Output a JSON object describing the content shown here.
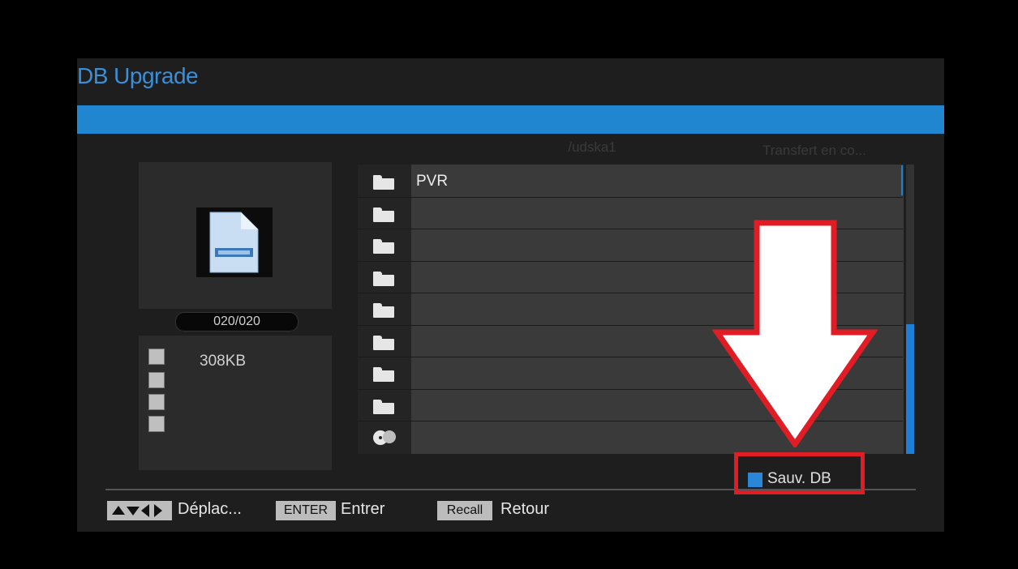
{
  "window": {
    "title": "DB Upgrade"
  },
  "browser": {
    "path": "/udska1",
    "status": "Transfert en co...",
    "rows": [
      {
        "icon": "folder-icon",
        "label": "PVR"
      },
      {
        "icon": "folder-icon",
        "label": ""
      },
      {
        "icon": "folder-icon",
        "label": ""
      },
      {
        "icon": "folder-icon",
        "label": ""
      },
      {
        "icon": "folder-icon",
        "label": ""
      },
      {
        "icon": "folder-icon",
        "label": ""
      },
      {
        "icon": "folder-icon",
        "label": ""
      },
      {
        "icon": "folder-icon",
        "label": ""
      },
      {
        "icon": "disc-icon",
        "label": ""
      }
    ]
  },
  "preview": {
    "counter": "020/020",
    "file_size": "308KB"
  },
  "legend": {
    "blue_label": "Sauv. DB",
    "blue_color": "#2a86d6"
  },
  "footer": {
    "move_label": "Déplac...",
    "enter_key": "ENTER",
    "enter_label": "Entrer",
    "recall_key": "Recall",
    "recall_label": "Retour"
  },
  "colors": {
    "accent": "#1f86cf",
    "highlight": "#e01c24"
  }
}
